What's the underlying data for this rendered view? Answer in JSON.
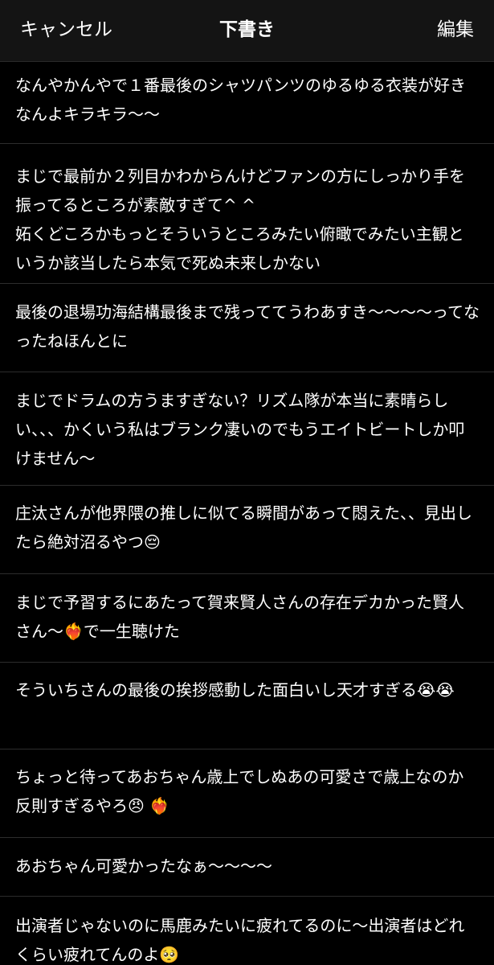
{
  "header": {
    "cancel_label": "キャンセル",
    "title": "下書き",
    "edit_label": "編集"
  },
  "drafts": [
    {
      "text": "なんやかんやで１番最後のシャツパンツのゆるゆる衣装が好きなんよキラキラ〜〜"
    },
    {
      "text": "まじで最前か２列目かわからんけどファンの方にしっかり手を振ってるところが素敵すぎて^ ^\n妬くどころかもっとそういうところみたい俯瞰でみたい主観というか該当したら本気で死ぬ未来しかない"
    },
    {
      "text": "最後の退場功海結構最後まで残っててうわあすき〜〜〜〜ってなったねほんとに"
    },
    {
      "text": "まじでドラムの方うますぎない？リズム隊が本当に素晴らしい、、、かくいう私はブランク凄いのでもうエイトビートしか叩けません〜"
    },
    {
      "text": "庄汰さんが他界隈の推しに似てる瞬間があって悶えた、、見出したら絶対沼るやつ😔"
    },
    {
      "text": "まじで予習するにあたって賀来賢人さんの存在デカかった賢人さん〜❤️‍🔥で一生聴けた"
    },
    {
      "text": "そういちさんの最後の挨拶感動した面白いし天才すぎる😭😭"
    },
    {
      "text": "ちょっと待ってあおちゃん歳上でしぬあの可愛さで歳上なのか反則すぎるやろ😠 ❤️‍🔥"
    },
    {
      "text": "あおちゃん可愛かったなぁ〜〜〜〜"
    },
    {
      "text": "出演者じゃないのに馬鹿みたいに疲れてるのに〜出演者はどれくらい疲れてんのよ🥺"
    }
  ]
}
